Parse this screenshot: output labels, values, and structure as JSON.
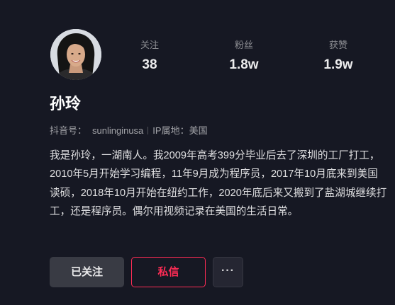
{
  "profile": {
    "name": "孙玲",
    "douyin_id_label": "抖音号：",
    "douyin_id": "sunlinginusa",
    "ip_location": "IP属地：美国",
    "bio": "我是孙玲，一湖南人。我2009年高考399分毕业后去了深圳的工厂打工，2010年5月开始学习编程，11年9月成为程序员，2017年10月底来到美国读硕，2018年10月开始在纽约工作，2020年底后来又搬到了盐湖城继续打工，还是程序员。偶尔用视频记录在美国的生活日常。"
  },
  "stats": [
    {
      "label": "关注",
      "value": "38"
    },
    {
      "label": "粉丝",
      "value": "1.8w"
    },
    {
      "label": "获赞",
      "value": "1.9w"
    }
  ],
  "actions": {
    "followed_label": "已关注",
    "message_label": "私信",
    "more_label": "···"
  },
  "colors": {
    "background": "#161823",
    "accent": "#fe2c55",
    "secondary_button": "#393b44"
  }
}
